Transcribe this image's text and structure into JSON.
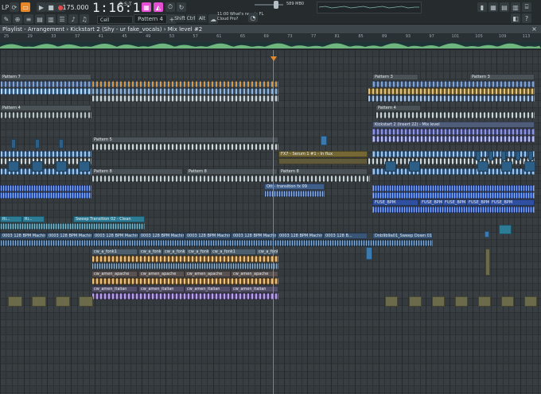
{
  "toolbar": {
    "logo": "LP",
    "tempo": "175.000",
    "time_main": "1:16:11",
    "time_sub": "B:S:T",
    "snap": "Cell",
    "pattern": "Pattern 4",
    "shift": "Shift",
    "ctrl": "Ctrl",
    "alt": "Alt",
    "news_time": "11:00",
    "news_text": "What's new in FL Cloud Pro?",
    "cpu": "589 MB",
    "cpu_sub": "0",
    "accent": "#e6872a",
    "record_color": "#e04a4a",
    "pink_color": "#e44fd4"
  },
  "playlist": {
    "title": "Playlist - Arrangement › Kickstart 2 (Shy - ur fake_vocals) › Mix level #2",
    "close": "×"
  },
  "timeline": {
    "bars": [
      "25",
      "29",
      "33",
      "37",
      "41",
      "45",
      "49",
      "53",
      "57",
      "61",
      "65",
      "69",
      "73",
      "77",
      "81",
      "85",
      "89",
      "93",
      "97",
      "101",
      "105",
      "109",
      "113",
      "117"
    ],
    "playhead_bar": "77"
  },
  "clips": {
    "c0": "Pattern 7",
    "c1": "Pattern 3",
    "c2": "Pattern 3",
    "c3": "Pattern 4",
    "c4": "Pattern 4",
    "c5": "Kickstart 2 (Insert 22) - Mix level",
    "c6": "Pattern 5",
    "c7": "FX7 - Serum 1 #1 - In flux",
    "c8": "Pattern 8",
    "c9": "Pattern 8",
    "c10": "Pattern 8",
    "c11": "Ott - transition fx 09",
    "c12": "FUSE_BPM",
    "c13": "FUSE_BPM",
    "c14": "FUSE_BPM",
    "c15": "FUSE_BPM",
    "c16": "FUSE_BPM",
    "c17": "Sweep Transition 02 - Clean",
    "c18": "Ri...",
    "c19": "Ri...",
    "c20": "0003 128 BPM Machine F#",
    "c21": "0003 128 BPM Machine F#",
    "c22": "0003 128 BPM Machine F#",
    "c23": "0003 128 BPM Machine F#",
    "c24": "0003 128 BPM Machine F#",
    "c25": "0003 128 BPM Machine F#",
    "c26": "0003 128 BPM Machine F#",
    "c27": "0003 128 BPM Machine F#",
    "c28": "0003 128 B...",
    "c29": "Dnb9b9a01_Sweep Down 01 160BPM",
    "c30": "cw_a_fonk1",
    "c31": "cw_a_fonk1",
    "c32": "cw_a_fonk1",
    "c33": "cw_a_fonk1",
    "c34": "cw_a_fonk1",
    "c35": "cw_a_fonk1",
    "c36": "cw_amen_apache",
    "c37": "cw_amen_apache",
    "c38": "cw_amen_apache",
    "c39": "cw_amen_apache",
    "c40": "cw_amen_italian",
    "c41": "cw_amen_italian",
    "c42": "cw_amen_italian",
    "c43": "cw_amen_italian"
  }
}
